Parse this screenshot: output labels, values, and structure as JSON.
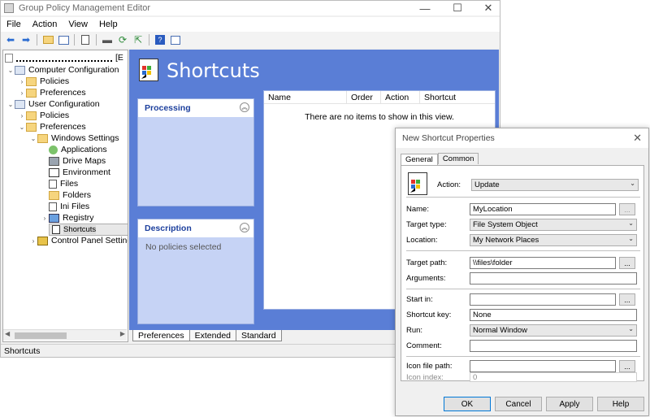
{
  "window": {
    "title": "Group Policy Management Editor",
    "minimize": "—",
    "maximize": "☐",
    "close": "✕"
  },
  "menu": [
    "File",
    "Action",
    "View",
    "Help"
  ],
  "toolbar": {
    "icons": [
      "back-icon",
      "forward-icon",
      "up-folder-icon",
      "show-hide-tree-icon",
      "copy-icon",
      "print-icon",
      "refresh-icon",
      "export-icon",
      "help-icon",
      "properties-icon"
    ]
  },
  "tree": {
    "root": "",
    "root_suffix": "[E",
    "computer_configuration": "Computer Configuration",
    "cc_policies": "Policies",
    "cc_preferences": "Preferences",
    "user_configuration": "User Configuration",
    "uc_policies": "Policies",
    "uc_preferences": "Preferences",
    "windows_settings": "Windows Settings",
    "applications": "Applications",
    "drive_maps": "Drive Maps",
    "environment": "Environment",
    "files": "Files",
    "folders": "Folders",
    "ini_files": "Ini Files",
    "registry": "Registry",
    "shortcuts": "Shortcuts",
    "control_panel": "Control Panel Setting"
  },
  "status": "Shortcuts",
  "main": {
    "title": "Shortcuts",
    "processing_header": "Processing",
    "description_header": "Description",
    "description_text": "No policies selected",
    "columns": [
      "Name",
      "Order",
      "Action",
      "Shortcut"
    ],
    "empty_message": "There are no items to show in this view.",
    "tabs": [
      "Preferences",
      "Extended",
      "Standard"
    ]
  },
  "dialog": {
    "title": "New Shortcut Properties",
    "tabs": [
      "General",
      "Common"
    ],
    "action_label": "Action:",
    "action_value": "Update",
    "name_label": "Name:",
    "name_value": "MyLocation",
    "target_type_label": "Target type:",
    "target_type_value": "File System Object",
    "location_label": "Location:",
    "location_value": "My Network Places",
    "target_path_label": "Target path:",
    "target_path_value": "\\\\files\\folder",
    "arguments_label": "Arguments:",
    "arguments_value": "",
    "start_in_label": "Start in:",
    "start_in_value": "",
    "shortcut_key_label": "Shortcut key:",
    "shortcut_key_value": "None",
    "run_label": "Run:",
    "run_value": "Normal Window",
    "comment_label": "Comment:",
    "comment_value": "",
    "icon_path_label": "Icon file path:",
    "icon_path_value": "",
    "icon_index_label": "Icon index:",
    "icon_index_value": "0",
    "browse": "...",
    "ok": "OK",
    "cancel": "Cancel",
    "apply": "Apply",
    "help": "Help"
  }
}
